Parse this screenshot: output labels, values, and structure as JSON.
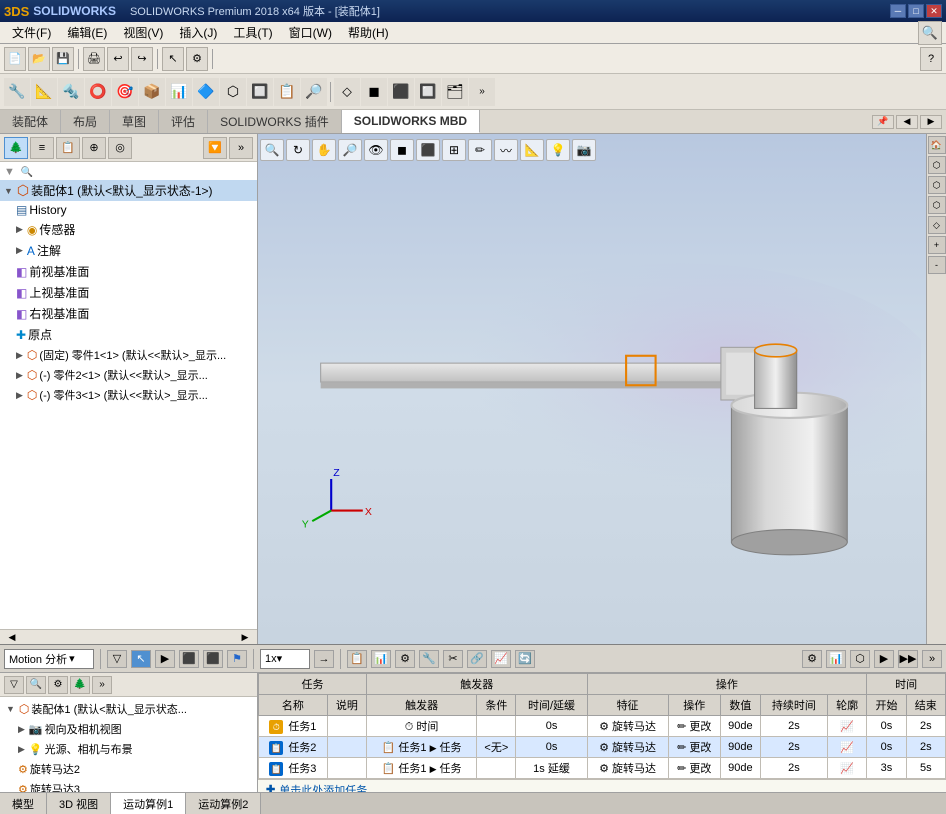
{
  "app": {
    "title": "SOLIDWORKS Premium 2018 x64 版本 - [装配体1]",
    "logo": "3DS SOLIDWORKS"
  },
  "menubar": {
    "items": [
      "文件(F)",
      "编辑(E)",
      "视图(V)",
      "插入(J)",
      "工具(T)",
      "窗口(W)",
      "帮助(H)"
    ]
  },
  "tabs": {
    "items": [
      "装配体",
      "布局",
      "草图",
      "评估",
      "SOLIDWORKS 插件",
      "SOLIDWORKS MBD"
    ],
    "active": "SOLIDWORKS MBD"
  },
  "tree": {
    "root": "装配体1 (默认<默认_显示状态-1>)",
    "items": [
      {
        "label": "History",
        "icon": "▤",
        "indent": 1,
        "color": "#336699"
      },
      {
        "label": "传感器",
        "icon": "◉",
        "indent": 1,
        "color": "#cc8800"
      },
      {
        "label": "注解",
        "icon": "A",
        "indent": 1,
        "color": "#0066cc"
      },
      {
        "label": "前视基准面",
        "icon": "◧",
        "indent": 1,
        "color": "#8855cc"
      },
      {
        "label": "上视基准面",
        "icon": "◧",
        "indent": 1,
        "color": "#8855cc"
      },
      {
        "label": "右视基准面",
        "icon": "◧",
        "indent": 1,
        "color": "#8855cc"
      },
      {
        "label": "原点",
        "icon": "✚",
        "indent": 1,
        "color": "#0088cc"
      },
      {
        "label": "(固定) 零件1<1> (默认<<默认>_显示...",
        "icon": "⬡",
        "indent": 1,
        "color": "#cc4400"
      },
      {
        "label": "(-) 零件2<1> (默认<<默认>_显示...",
        "icon": "⬡",
        "indent": 1,
        "color": "#cc4400"
      },
      {
        "label": "(-) 零件3<1> (默认<<默认>_显示...",
        "icon": "⬡",
        "indent": 1,
        "color": "#cc4400"
      }
    ]
  },
  "motion_bar": {
    "label": "Motion 分析",
    "dropdown_arrow": "▾",
    "buttons": [
      "▶",
      "⬛",
      "⬛"
    ],
    "play_label": "▶",
    "stop_label": "⬛",
    "speed": "1x",
    "speed_arrow": "▾"
  },
  "bottom_tree": {
    "root": "装配体1 (默认<默认_显示状态...",
    "items": [
      {
        "label": "视向及相机视图",
        "icon": "📷",
        "indent": 1
      },
      {
        "label": "光源、相机与布景",
        "icon": "💡",
        "indent": 1
      },
      {
        "label": "旋转马达2",
        "icon": "⚙",
        "indent": 1
      },
      {
        "label": "旋转马达3",
        "icon": "⚙",
        "indent": 1
      }
    ]
  },
  "table": {
    "col_groups": [
      {
        "label": "任务",
        "colspan": 2
      },
      {
        "label": "触发器",
        "colspan": 3
      },
      {
        "label": "操作",
        "colspan": 5
      },
      {
        "label": "时间",
        "colspan": 2
      }
    ],
    "columns": [
      "名称",
      "说明",
      "触发器",
      "条件",
      "时间/延缓",
      "特征",
      "操作",
      "数值",
      "持续时间",
      "轮廓",
      "开始",
      "结束"
    ],
    "rows": [
      {
        "name": "任务1",
        "desc": "",
        "trigger_icon": "⏱",
        "trigger": "时间",
        "condition": "",
        "time": "0s",
        "feature_icon": "⚙",
        "feature": "旋转马达",
        "op": "更改",
        "value": "90de",
        "duration": "2s",
        "profile_icon": "📈",
        "start": "0s",
        "end": "2s"
      },
      {
        "name": "任务2",
        "desc": "",
        "trigger_icon": "📋",
        "trigger": "任务1",
        "trigger2": "任务",
        "condition": "<无>",
        "time": "0s",
        "feature_icon": "⚙",
        "feature": "旋转马达",
        "op": "更改",
        "value": "90de",
        "duration": "2s",
        "profile_icon": "📈",
        "start": "0s",
        "end": "2s"
      },
      {
        "name": "任务3",
        "desc": "",
        "trigger_icon": "📋",
        "trigger": "任务1",
        "trigger2": "任务",
        "condition": "",
        "time": "1s 延缓",
        "feature_icon": "⚙",
        "feature": "旋转马达",
        "op": "更改",
        "value": "90de",
        "duration": "2s",
        "profile_icon": "📈",
        "start": "3s",
        "end": "5s"
      }
    ],
    "add_row_label": "单击此处添加任务"
  },
  "bottom_tabs": {
    "items": [
      "模型",
      "3D 视图",
      "运动算例1",
      "运动算例2"
    ],
    "active": "运动算例1"
  },
  "statusbar": {
    "text": ""
  }
}
